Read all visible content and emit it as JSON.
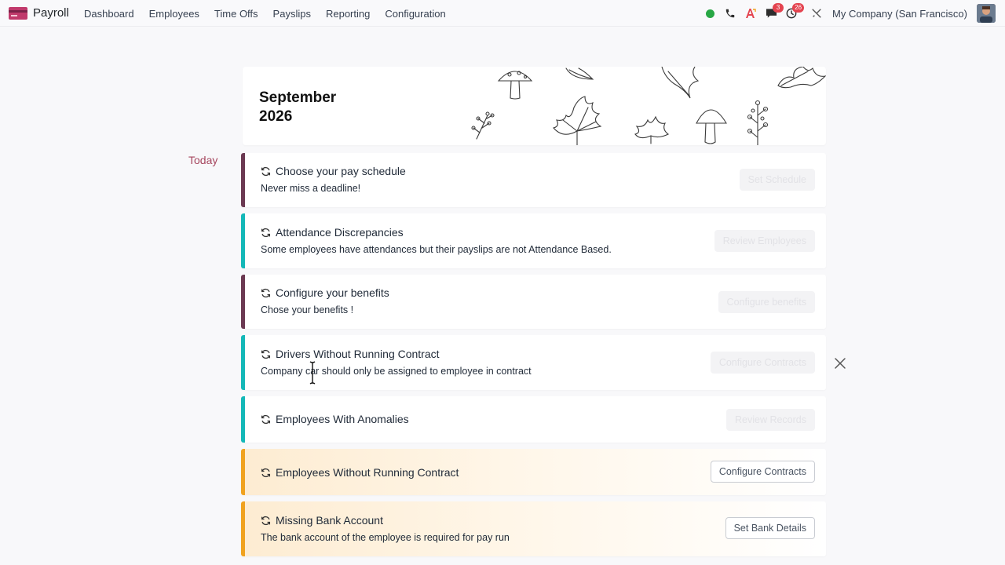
{
  "navbar": {
    "app_name": "Payroll",
    "menu": [
      "Dashboard",
      "Employees",
      "Time Offs",
      "Payslips",
      "Reporting",
      "Configuration"
    ],
    "systray": {
      "icons": [
        "presence-online-icon",
        "phone-icon",
        "ai-icon",
        "chat-icon",
        "activity-clock-icon",
        "debug-tools-icon"
      ],
      "chat_badge": "3",
      "activity_badge": "26",
      "company": "My Company (San Francisco)"
    }
  },
  "banner": {
    "month": "September",
    "year": "2026"
  },
  "today_label": "Today",
  "cards": [
    {
      "title": "Choose your pay schedule",
      "description": "Never miss a deadline!",
      "button": "Set Schedule",
      "style": "plum",
      "button_state": "disabled"
    },
    {
      "title": "Attendance Discrepancies",
      "description": "Some employees have attendances but their payslips are not Attendance Based.",
      "button": "Review Employees",
      "style": "teal",
      "button_state": "disabled"
    },
    {
      "title": "Configure your benefits",
      "description": "Chose your benefits !",
      "button": "Configure benefits",
      "style": "plum",
      "button_state": "disabled"
    },
    {
      "title": "Drivers Without Running Contract",
      "description": "Company car should only be assigned to employee in contract",
      "button": "Configure Contracts",
      "style": "teal",
      "button_state": "disabled"
    },
    {
      "title": "Employees With Anomalies",
      "description": "",
      "button": "Review Records",
      "style": "teal",
      "button_state": "disabled"
    },
    {
      "title": "Employees Without Running Contract",
      "description": "",
      "button": "Configure Contracts",
      "style": "warn",
      "button_state": "active"
    },
    {
      "title": "Missing Bank Account",
      "description": "The bank account of the employee is required for pay run",
      "button": "Set Bank Details",
      "style": "warn",
      "button_state": "active"
    }
  ],
  "colors": {
    "accent": "#714b67",
    "today": "#a6465e",
    "teal": "#14b8b8",
    "warning": "#f0a21f"
  }
}
